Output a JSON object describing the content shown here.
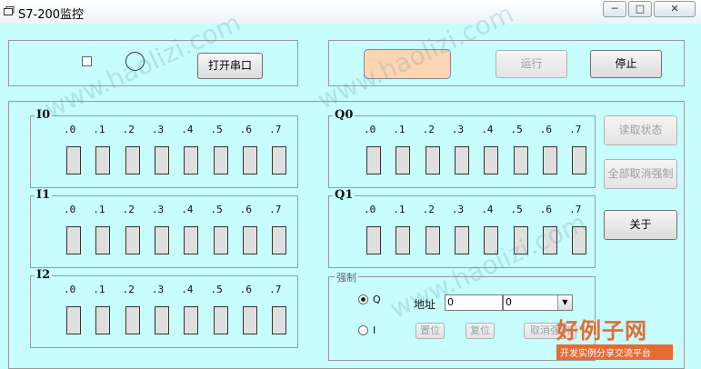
{
  "window": {
    "title": "S7-200监控",
    "min": "─",
    "max": "□",
    "close": "✕"
  },
  "top": {
    "open_port": "打开串口",
    "run": "运行",
    "stop": "停止",
    "status_color": "#fcd5b5"
  },
  "inputs": [
    {
      "name": "I0"
    },
    {
      "name": "I1"
    },
    {
      "name": "I2"
    }
  ],
  "outputs": [
    {
      "name": "Q0"
    },
    {
      "name": "Q1"
    }
  ],
  "bits": [
    ".0",
    ".1",
    ".2",
    ".3",
    ".4",
    ".5",
    ".6",
    ".7"
  ],
  "side": {
    "read_status": "读取状态",
    "cancel_all": "全部取消强制",
    "about": "关于"
  },
  "force": {
    "title": "强制",
    "q": "Q",
    "i": "I",
    "addr": "地址",
    "addr_value": "0",
    "dd_value": "0",
    "set": "置位",
    "reset": "复位",
    "cancel": "取消强制"
  },
  "watermark": {
    "url": "www.haolizi.com",
    "brand": "好例子网",
    "slogan": "开发实例分享交流平台"
  }
}
